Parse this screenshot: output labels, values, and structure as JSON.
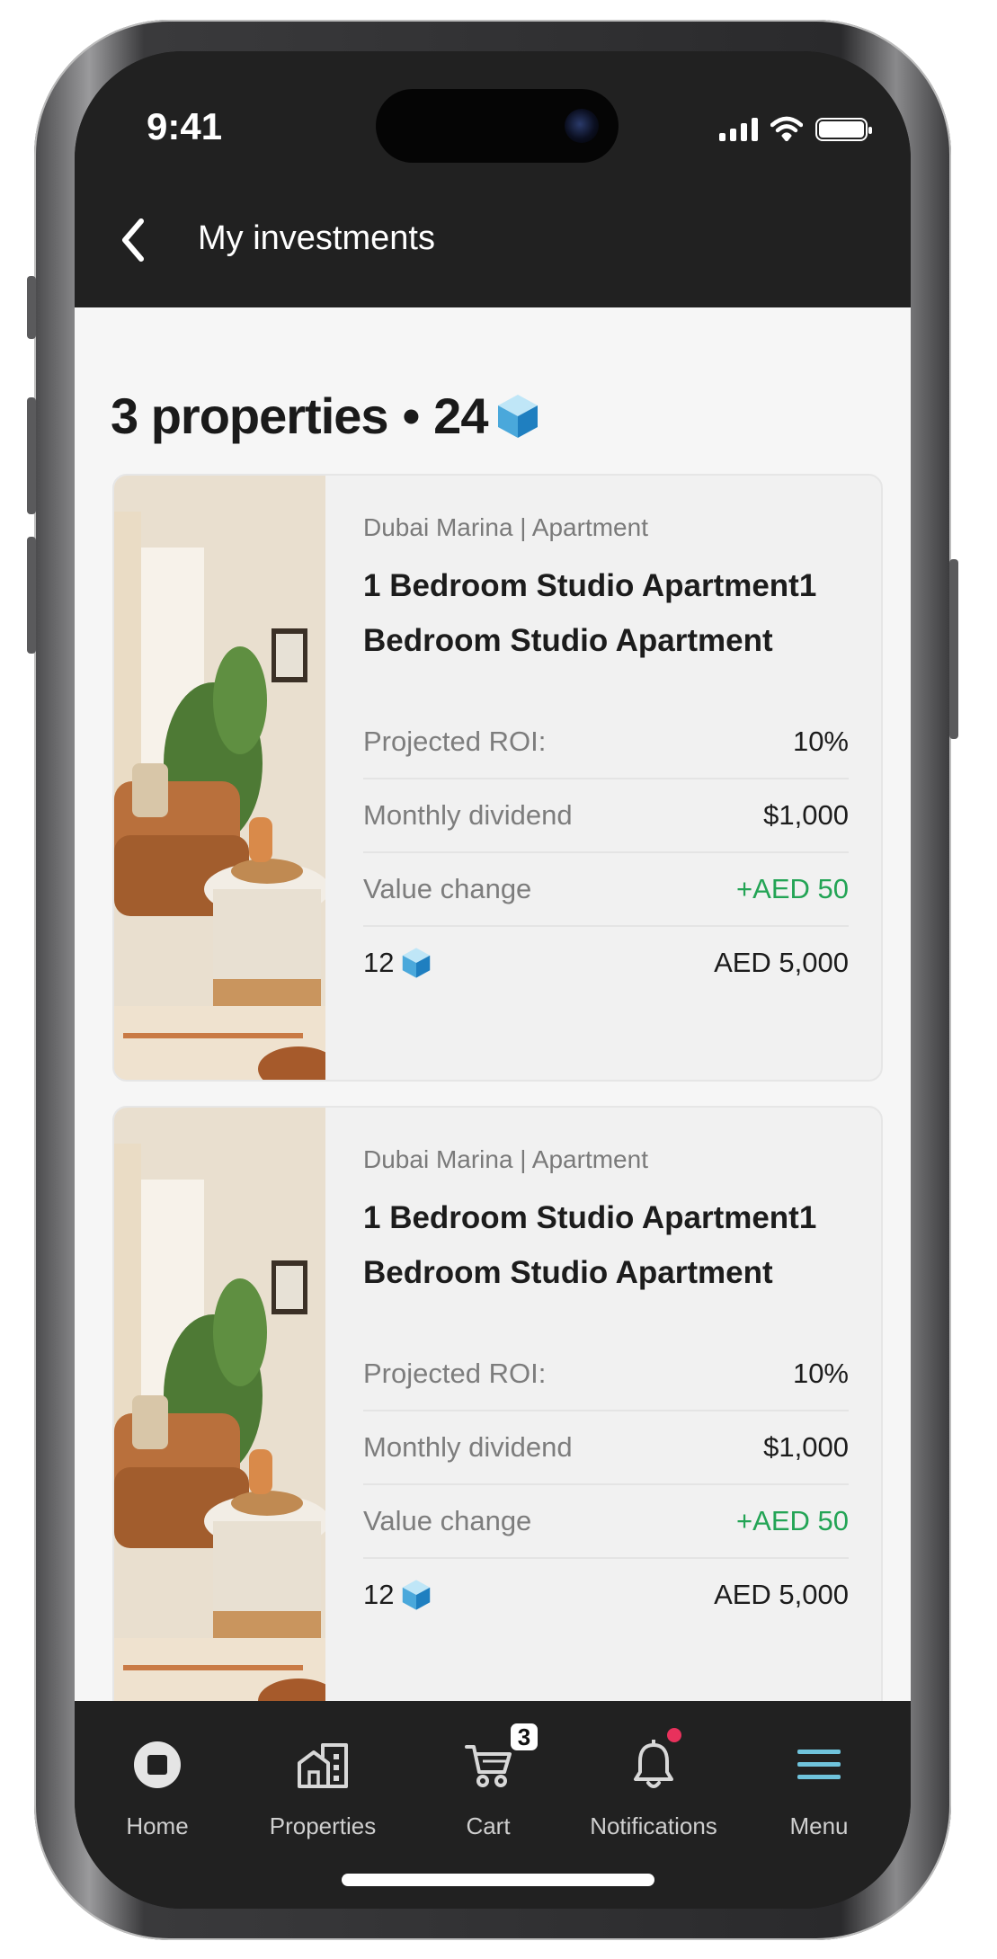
{
  "status_bar": {
    "time": "9:41"
  },
  "nav": {
    "title": "My investments",
    "back_icon": "chevron-left-icon"
  },
  "summary": {
    "properties_text": "3 properties",
    "separator": "•",
    "tokens": "24",
    "token_icon": "cube-icon"
  },
  "properties": [
    {
      "location": "Dubai Marina | Apartment",
      "title": "1 Bedroom Studio Apartment1 Bedroom Studio Apartment",
      "roi_label": "Projected ROI:",
      "roi_value": "10%",
      "dividend_label": "Monthly dividend",
      "dividend_value": "$1,000",
      "change_label": "Value change",
      "change_value": "+AED 50",
      "tokens": "12",
      "amount": "AED 5,000"
    },
    {
      "location": "Dubai Marina | Apartment",
      "title": "1 Bedroom Studio Apartment1 Bedroom Studio Apartment",
      "roi_label": "Projected ROI:",
      "roi_value": "10%",
      "dividend_label": "Monthly dividend",
      "dividend_value": "$1,000",
      "change_label": "Value change",
      "change_value": "+AED 50",
      "tokens": "12",
      "amount": "AED 5,000"
    }
  ],
  "tabbar": {
    "items": [
      {
        "label": "Home",
        "icon": "home-icon"
      },
      {
        "label": "Properties",
        "icon": "buildings-icon"
      },
      {
        "label": "Cart",
        "icon": "cart-icon",
        "badge": "3"
      },
      {
        "label": "Notifications",
        "icon": "bell-icon"
      },
      {
        "label": "Menu",
        "icon": "menu-icon"
      }
    ]
  },
  "colors": {
    "accent_menu": "#6fc3dc",
    "positive": "#23a455",
    "notification_dot": "#e8315c"
  }
}
